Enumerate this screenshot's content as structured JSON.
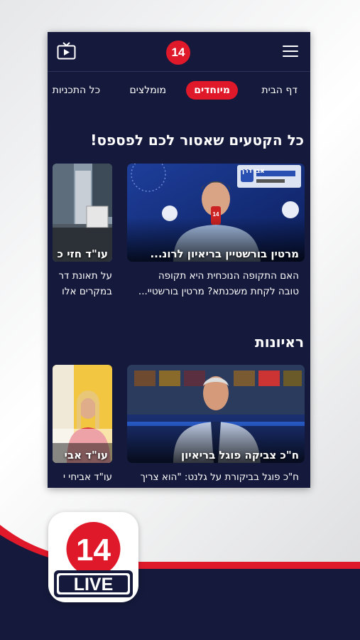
{
  "header": {
    "logo_text": "14",
    "menu_icon": "hamburger-menu-icon",
    "tv_icon": "tv-icon"
  },
  "tabs": [
    {
      "label": "דף הבית",
      "active": false
    },
    {
      "label": "מיוחדים",
      "active": true
    },
    {
      "label": "מומלצים",
      "active": false
    },
    {
      "label": "כל התכניות",
      "active": false
    }
  ],
  "sections": [
    {
      "title": "כל הקטעים שאסור לכם לפספס!",
      "cards": [
        {
          "title": "מרטין בורשטיין בריאיון לרונ...",
          "desc_line1": "האם התקופה הנוכחית היא תקופה",
          "desc_line2": "טובה לקחת משכנתא? מרטין בורשטיי...",
          "overlay_text": "אבי דרך"
        },
        {
          "title": "עו\"ד חזי כ",
          "desc_line1": "על תאונת דר",
          "desc_line2": "במקרים אלו"
        }
      ]
    },
    {
      "title": "ראיונות",
      "cards": [
        {
          "title": "ח\"כ צביקה פוגל בריאיון",
          "desc_line1": "ח\"כ פוגל בביקורת על גלנט: \"הוא צריך"
        },
        {
          "title": "עו\"ד אבי",
          "desc_line1": "עו\"ד אביחי י"
        }
      ]
    }
  ],
  "app_icon": {
    "number": "14",
    "label": "LIVE"
  },
  "colors": {
    "brand_red": "#e0192a",
    "navy": "#151a3c"
  }
}
